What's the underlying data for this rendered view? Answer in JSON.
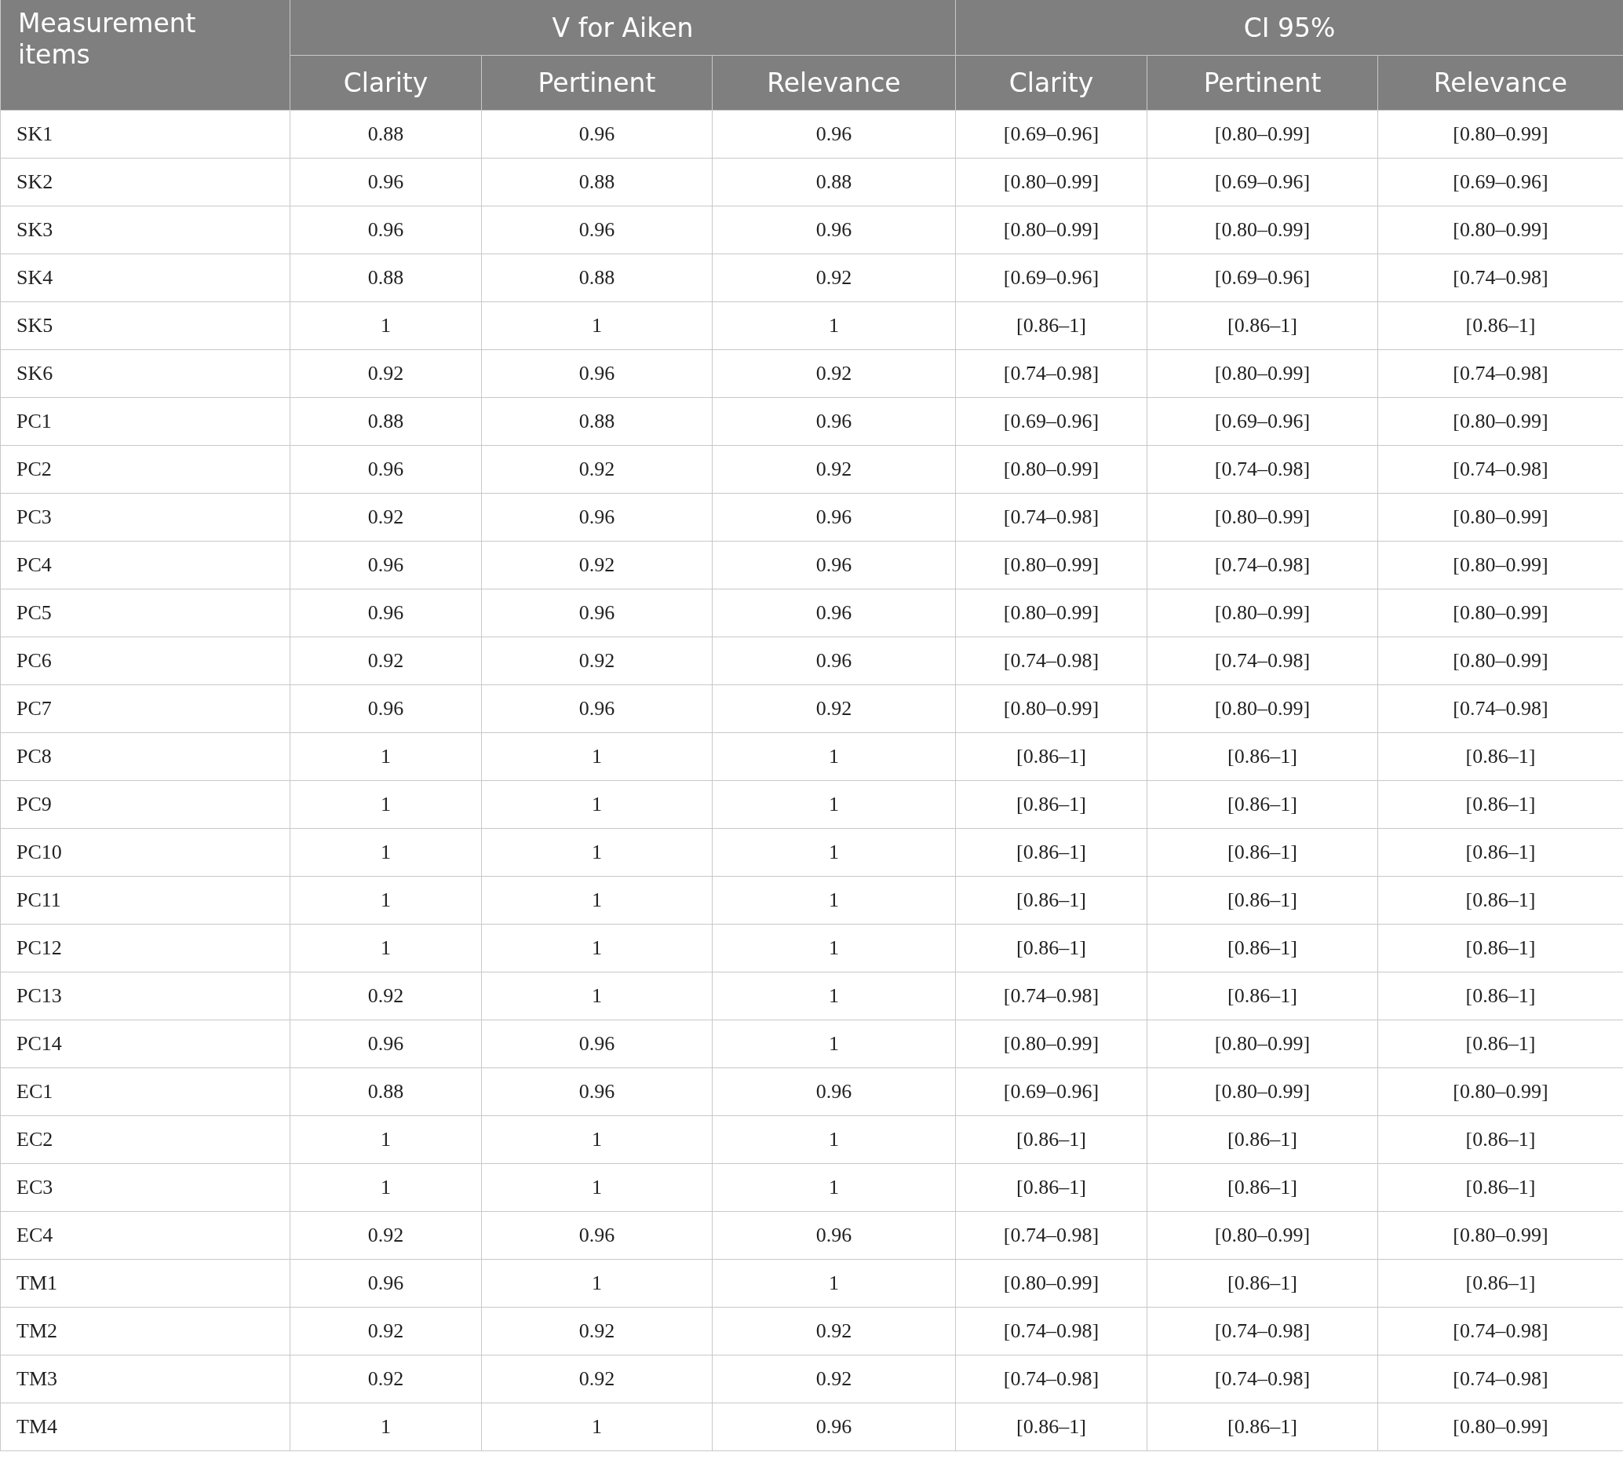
{
  "table": {
    "header": {
      "row_label": "Measurement items",
      "groups": [
        {
          "label": "V for Aiken",
          "columns": [
            "Clarity",
            "Pertinent",
            "Relevance"
          ]
        },
        {
          "label": "CI 95%",
          "columns": [
            "Clarity",
            "Pertinent",
            "Relevance"
          ]
        }
      ]
    },
    "rows": [
      {
        "item": "SK1",
        "cells": [
          "0.88",
          "0.96",
          "0.96",
          "[0.69–0.96]",
          "[0.80–0.99]",
          "[0.80–0.99]"
        ]
      },
      {
        "item": "SK2",
        "cells": [
          "0.96",
          "0.88",
          "0.88",
          "[0.80–0.99]",
          "[0.69–0.96]",
          "[0.69–0.96]"
        ]
      },
      {
        "item": "SK3",
        "cells": [
          "0.96",
          "0.96",
          "0.96",
          "[0.80–0.99]",
          "[0.80–0.99]",
          "[0.80–0.99]"
        ]
      },
      {
        "item": "SK4",
        "cells": [
          "0.88",
          "0.88",
          "0.92",
          "[0.69–0.96]",
          "[0.69–0.96]",
          "[0.74–0.98]"
        ]
      },
      {
        "item": "SK5",
        "cells": [
          "1",
          "1",
          "1",
          "[0.86–1]",
          "[0.86–1]",
          "[0.86–1]"
        ]
      },
      {
        "item": "SK6",
        "cells": [
          "0.92",
          "0.96",
          "0.92",
          "[0.74–0.98]",
          "[0.80–0.99]",
          "[0.74–0.98]"
        ]
      },
      {
        "item": "PC1",
        "cells": [
          "0.88",
          "0.88",
          "0.96",
          "[0.69–0.96]",
          "[0.69–0.96]",
          "[0.80–0.99]"
        ]
      },
      {
        "item": "PC2",
        "cells": [
          "0.96",
          "0.92",
          "0.92",
          "[0.80–0.99]",
          "[0.74–0.98]",
          "[0.74–0.98]"
        ]
      },
      {
        "item": "PC3",
        "cells": [
          "0.92",
          "0.96",
          "0.96",
          "[0.74–0.98]",
          "[0.80–0.99]",
          "[0.80–0.99]"
        ]
      },
      {
        "item": "PC4",
        "cells": [
          "0.96",
          "0.92",
          "0.96",
          "[0.80–0.99]",
          "[0.74–0.98]",
          "[0.80–0.99]"
        ]
      },
      {
        "item": "PC5",
        "cells": [
          "0.96",
          "0.96",
          "0.96",
          "[0.80–0.99]",
          "[0.80–0.99]",
          "[0.80–0.99]"
        ]
      },
      {
        "item": "PC6",
        "cells": [
          "0.92",
          "0.92",
          "0.96",
          "[0.74–0.98]",
          "[0.74–0.98]",
          "[0.80–0.99]"
        ]
      },
      {
        "item": "PC7",
        "cells": [
          "0.96",
          "0.96",
          "0.92",
          "[0.80–0.99]",
          "[0.80–0.99]",
          "[0.74–0.98]"
        ]
      },
      {
        "item": "PC8",
        "cells": [
          "1",
          "1",
          "1",
          "[0.86–1]",
          "[0.86–1]",
          "[0.86–1]"
        ]
      },
      {
        "item": "PC9",
        "cells": [
          "1",
          "1",
          "1",
          "[0.86–1]",
          "[0.86–1]",
          "[0.86–1]"
        ]
      },
      {
        "item": "PC10",
        "cells": [
          "1",
          "1",
          "1",
          "[0.86–1]",
          "[0.86–1]",
          "[0.86–1]"
        ]
      },
      {
        "item": "PC11",
        "cells": [
          "1",
          "1",
          "1",
          "[0.86–1]",
          "[0.86–1]",
          "[0.86–1]"
        ]
      },
      {
        "item": "PC12",
        "cells": [
          "1",
          "1",
          "1",
          "[0.86–1]",
          "[0.86–1]",
          "[0.86–1]"
        ]
      },
      {
        "item": "PC13",
        "cells": [
          "0.92",
          "1",
          "1",
          "[0.74–0.98]",
          "[0.86–1]",
          "[0.86–1]"
        ]
      },
      {
        "item": "PC14",
        "cells": [
          "0.96",
          "0.96",
          "1",
          "[0.80–0.99]",
          "[0.80–0.99]",
          "[0.86–1]"
        ]
      },
      {
        "item": "EC1",
        "cells": [
          "0.88",
          "0.96",
          "0.96",
          "[0.69–0.96]",
          "[0.80–0.99]",
          "[0.80–0.99]"
        ]
      },
      {
        "item": "EC2",
        "cells": [
          "1",
          "1",
          "1",
          "[0.86–1]",
          "[0.86–1]",
          "[0.86–1]"
        ]
      },
      {
        "item": "EC3",
        "cells": [
          "1",
          "1",
          "1",
          "[0.86–1]",
          "[0.86–1]",
          "[0.86–1]"
        ]
      },
      {
        "item": "EC4",
        "cells": [
          "0.92",
          "0.96",
          "0.96",
          "[0.74–0.98]",
          "[0.80–0.99]",
          "[0.80–0.99]"
        ]
      },
      {
        "item": "TM1",
        "cells": [
          "0.96",
          "1",
          "1",
          "[0.80–0.99]",
          "[0.86–1]",
          "[0.86–1]"
        ]
      },
      {
        "item": "TM2",
        "cells": [
          "0.92",
          "0.92",
          "0.92",
          "[0.74–0.98]",
          "[0.74–0.98]",
          "[0.74–0.98]"
        ]
      },
      {
        "item": "TM3",
        "cells": [
          "0.92",
          "0.92",
          "0.92",
          "[0.74–0.98]",
          "[0.74–0.98]",
          "[0.74–0.98]"
        ]
      },
      {
        "item": "TM4",
        "cells": [
          "1",
          "1",
          "0.96",
          "[0.86–1]",
          "[0.86–1]",
          "[0.80–0.99]"
        ]
      }
    ]
  }
}
